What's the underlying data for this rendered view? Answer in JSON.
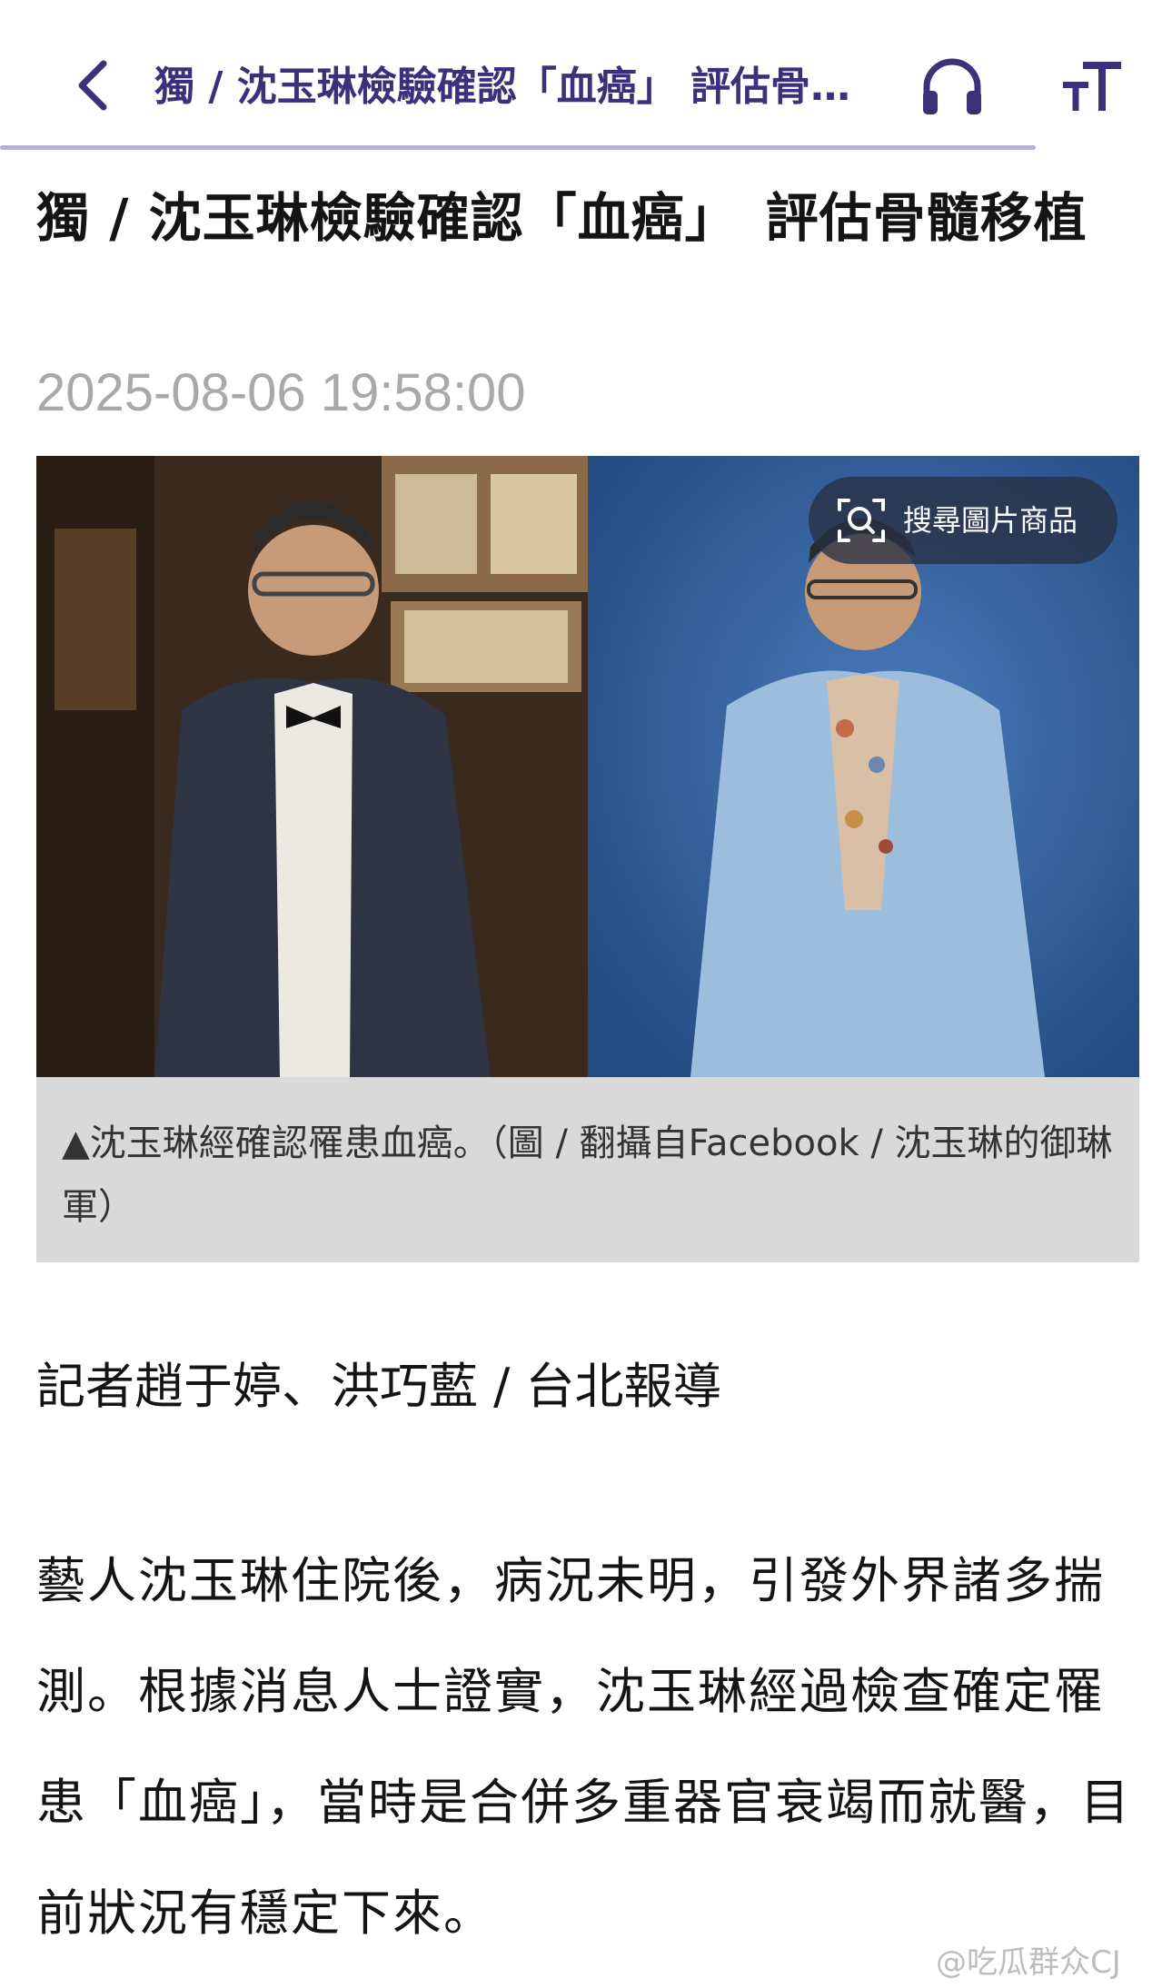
{
  "nav": {
    "title": "獨 / 沈玉琳檢驗確認「血癌」 評估骨髓移植",
    "back_icon": "chevron-left-icon",
    "audio_icon": "headphones-icon",
    "fontsize_icon": "text-size-icon",
    "accent_color": "#3d2f7a"
  },
  "article": {
    "headline": "獨 / 沈玉琳檢驗確認「血癌」　評估骨髓移植",
    "timestamp": "2025-08-06 19:58:00",
    "image": {
      "search_label": "搜尋圖片商品",
      "caption": "▲沈玉琳經確認罹患血癌。（圖 / 翻攝自Facebook / 沈玉琳的御琳軍）"
    },
    "byline": "記者趙于婷、洪巧藍 / 台北報導",
    "paragraph": "藝人沈玉琳住院後，病況未明，引發外界諸多揣測。根據消息人士證實，沈玉琳經過檢查確定罹患「血癌」，當時是合併多重器官衰竭而就醫，目前狀況有穩定下來。"
  },
  "watermark": "@吃瓜群众CJ"
}
